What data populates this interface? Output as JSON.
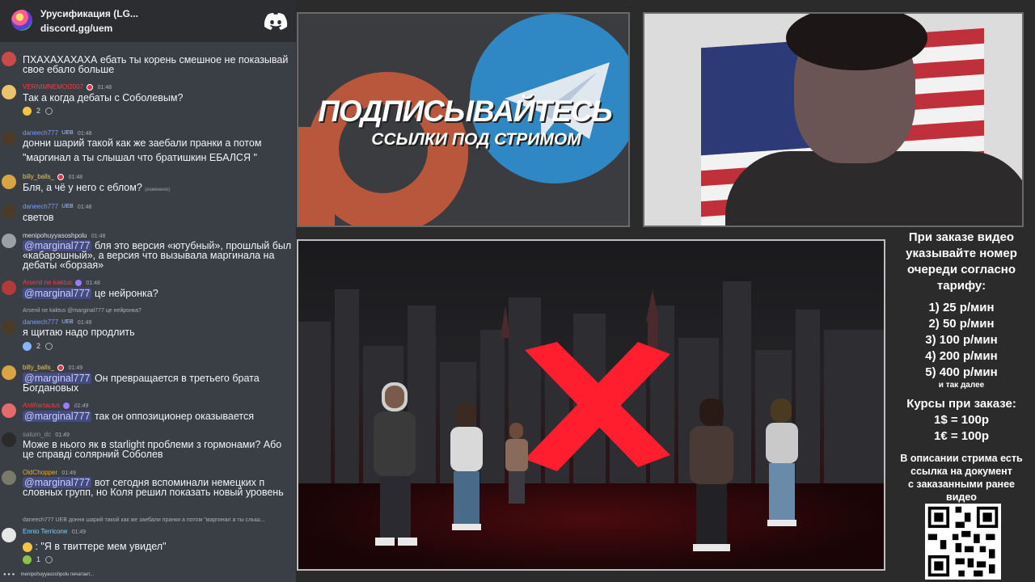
{
  "discord": {
    "server_name": "Урусификация (LG...",
    "invite": "discord.gg/uem",
    "icon": "discord-icon"
  },
  "chat": {
    "messages": [
      {
        "user": "",
        "time": "",
        "text": "ПХАХАХАХАХА ебать ты корень смешное не показывай свое ебало больше",
        "user_color": "#f2f3f5"
      },
      {
        "user": "VERNIMNEMOI2007",
        "time": "01:48",
        "text": "Так а когда дебаты с Соболевым?",
        "user_color": "#f23f43",
        "reaction_count": "2"
      },
      {
        "user": "daneech777",
        "time": "01:48",
        "badge": "UEB",
        "text_a": "донни шарий такой как же заебали пранки а потом",
        "text_b": "\"маргинал а ты слышал что братишкин ЕБАЛСЯ  \"",
        "user_color": "#7a9cff"
      },
      {
        "user": "billy_balls_",
        "time": "01:48",
        "text": "Бля, а чё у него с еблом?",
        "edited": "(изменено)",
        "user_color": "#f5c542"
      },
      {
        "user": "daneech777",
        "time": "01:48",
        "badge": "UEB",
        "text": "светов",
        "user_color": "#7a9cff"
      },
      {
        "user": "menipohuyyasoshpolu",
        "time": "01:48",
        "mention": "@marginal777",
        "text": " бля это версия «ютубный», прошлый был «кабарэшный», а версия что вызывала маргинала на дебаты «борзая»",
        "user_color": "#e0e0e0"
      },
      {
        "user": "Arsenil ne kaktus",
        "time": "01:48",
        "mention": "@marginal777",
        "text": "  це нейронка?",
        "user_color": "#f23f43"
      },
      {
        "reply": "Arsenil ne kaktus @marginal777 це нейронка?",
        "user": "daneech777",
        "time": "01:49",
        "badge": "UEB",
        "text": "я щитаю надо продлить",
        "user_color": "#7a9cff",
        "reaction_count": "2"
      },
      {
        "user": "billy_balls_",
        "time": "01:49",
        "mention": "@marginal777",
        "text": " Он превращается в третьего брата Богдановых",
        "user_color": "#f5c542"
      },
      {
        "user": "Antihartaclus",
        "time": "01:49",
        "mention": "@marginal777",
        "text": " так он оппозиционер оказывается",
        "user_color": "#f23f43"
      },
      {
        "user": "saturn_dc",
        "time": "01:49",
        "text": "Може в нього як в starlight проблеми з гормонами? Або це справді солярний Соболев",
        "user_color": "#8e9297"
      },
      {
        "user": "OldChopper",
        "time": "01:49",
        "mention": "@marginal777",
        "text": " вот сегодня вспоминали немецких п словных групп, но Коля решил показать новый уровень",
        "user_color": "#f5a623"
      },
      {
        "reply": "daneech777 UEB донни шарий такой как же заебали пранки а потом \"маргинал а ты слыш...",
        "user": "Ennio Terricone",
        "time": "01:49",
        "text": ": \"Я в твиттере мем увидел\"",
        "user_color": "#7ad3ff",
        "reaction_count": "1"
      }
    ],
    "typing": "menipohuyyasoshpolu печатает..."
  },
  "banner": {
    "title": "ПОДПИСЫВАЙТЕСЬ",
    "subtitle": "ССЫЛКИ ПОД СТРИМОМ"
  },
  "info": {
    "heading": [
      "При заказе видео",
      "указывайте номер",
      "очереди согласно",
      "тарифу:"
    ],
    "prices": [
      "1) 25 р/мин",
      "2) 50 р/мин",
      "3) 100 р/мин",
      "4) 200 р/мин",
      "5) 400 р/мин"
    ],
    "etc": "и так далее",
    "rates_title": "Курсы при заказе:",
    "rates": [
      "1$ = 100р",
      "1€ = 100р"
    ],
    "note": [
      "В описании стрима есть",
      "ссылка на документ",
      "с заказанными ранее",
      "видео"
    ]
  },
  "colors": {
    "accent": "#5865f2",
    "banner_red": "#b9573c",
    "telegram_blue": "#2f87c4",
    "cross_red": "#ff1e2d"
  }
}
